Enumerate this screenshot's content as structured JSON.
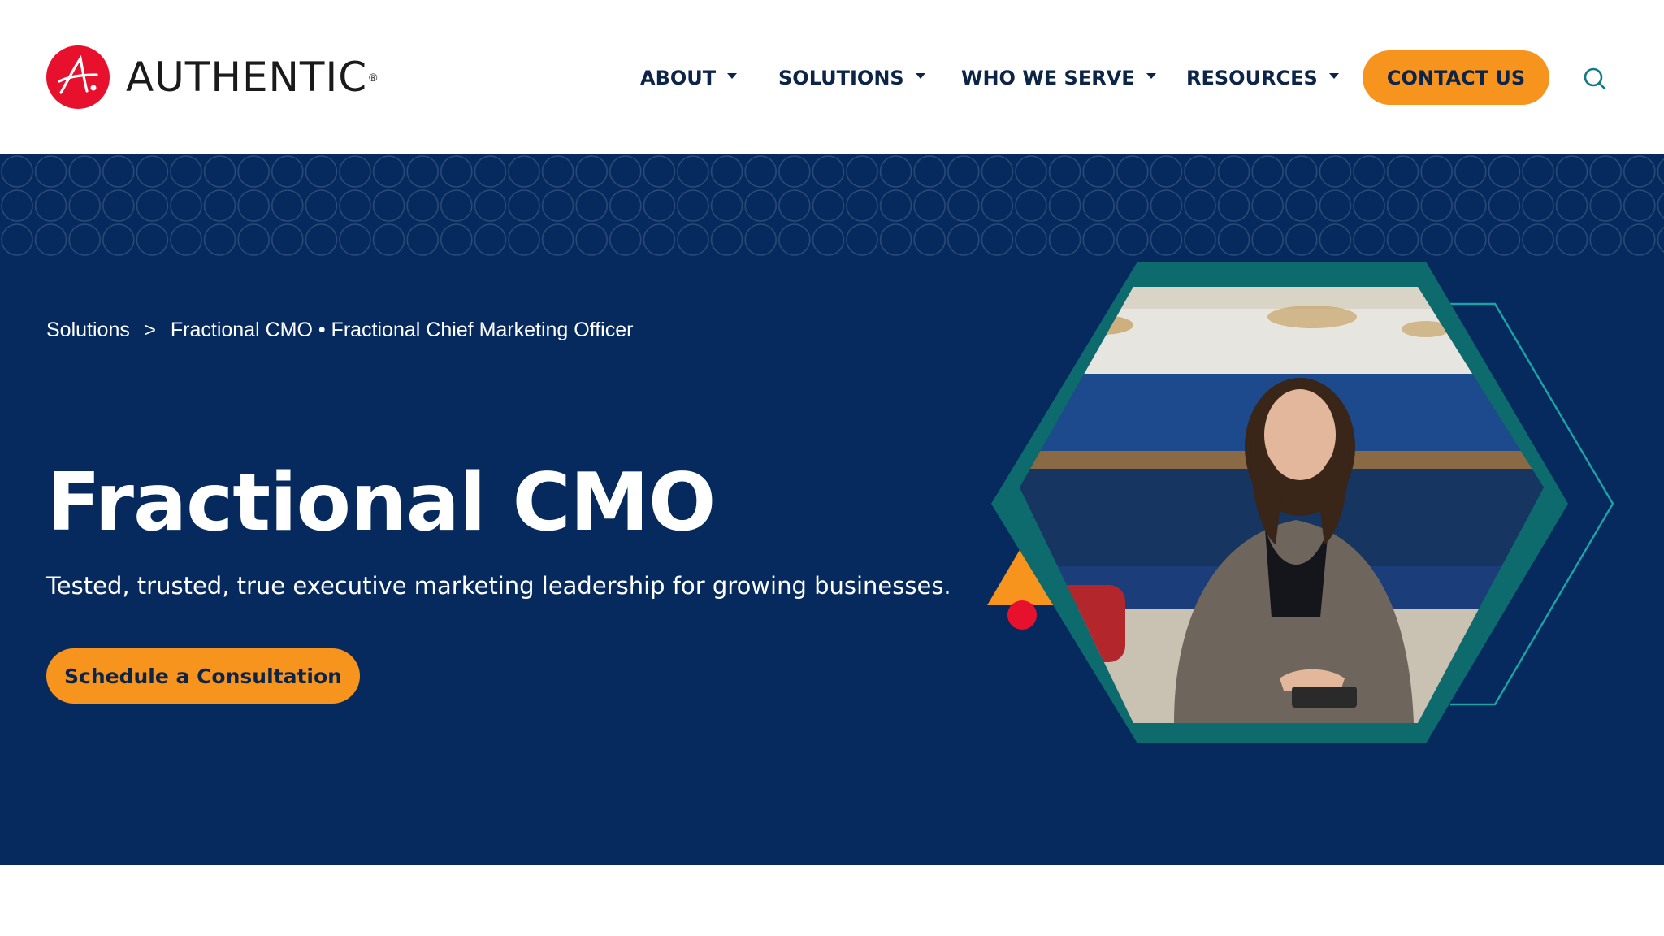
{
  "header": {
    "logo_text": "AUTHENTIC",
    "logo_reg": "®",
    "nav": [
      {
        "label": "ABOUT"
      },
      {
        "label": "SOLUTIONS"
      },
      {
        "label": "WHO WE SERVE"
      },
      {
        "label": "RESOURCES"
      }
    ],
    "contact_label": "CONTACT US",
    "search_icon": "search-icon"
  },
  "breadcrumb": {
    "items": [
      "Solutions",
      "Fractional CMO • Fractional Chief Marketing Officer"
    ],
    "separator": ">"
  },
  "hero": {
    "title": "Fractional CMO",
    "subtitle": "Tested, trusted, true executive marketing leadership for growing businesses.",
    "cta_label": "Schedule a Consultation"
  },
  "colors": {
    "brand_red": "#e8112d",
    "navy": "#062a5e",
    "accent_orange": "#f7941d",
    "teal": "#0d6b6e"
  }
}
